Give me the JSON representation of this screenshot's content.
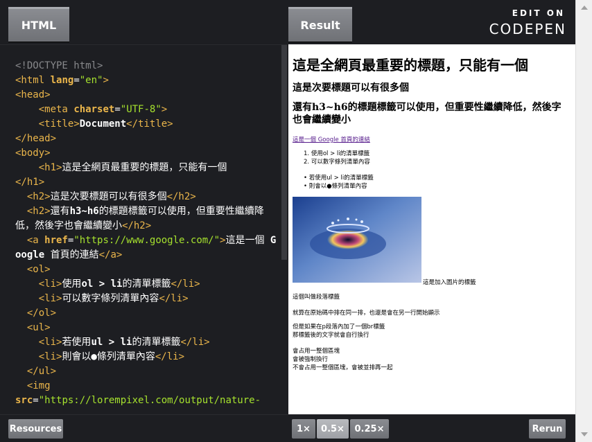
{
  "tabs": {
    "html": "HTML",
    "result": "Result"
  },
  "codepen": {
    "edit_on": "EDIT ON",
    "word": "CODEPEN"
  },
  "code_lines": [
    "<!DOCTYPE html>",
    "<html lang=\"en\">",
    "<head>",
    "<meta charset=\"UTF-8\">",
    "<title>Document</title>",
    "</head>",
    "<body>",
    "<h1>這是全網頁最重要的標題，只能有一個</h1>",
    "<h2>這是次要標題可以有很多個</h2>",
    "<h2>還有h3~h6的標題標籤可以使用，但重要性繼續降低，然後字也會繼續變小</h2>",
    "<a href=\"https://www.google.com/\">這是一個 Google 首頁的連結</a>",
    "<ol>",
    "<li>使用ol > li的清單標籤</li>",
    "<li>可以數字條列清單內容</li>",
    "</ol>",
    "<ul>",
    "<li>若使用ul > li的清單標籤</li>",
    "<li>則會以●條列清單內容</li>",
    "</ul>",
    "<img src=\"https://lorempixel.com/output/nature-"
  ],
  "code": {
    "doctype": "<!DOCTYPE html>",
    "html_open": "<html",
    "lang_attr": "lang",
    "lang_eq": "=",
    "lang_val": "\"en\"",
    "gt": ">",
    "head_open": "<head>",
    "meta_open": "<meta",
    "charset_attr": "charset",
    "charset_val": "\"UTF-8\"",
    "title_open": "<title>",
    "title_text": "Document",
    "title_close": "</title>",
    "head_close": "</head>",
    "body_open": "<body>",
    "h1_open": "<h1>",
    "h1_text": "這是全網頁最重要的標題，只能有一個",
    "h1_close": "</h1>",
    "h2_open": "<h2>",
    "h2a_text": "這是次要標題可以有很多個",
    "h2_close": "</h2>",
    "h2b_pre": "還有",
    "h2b_bold": "h3~h6",
    "h2b_post": "的標題標籤可以使用，但重要性繼續降低，然後字也會繼續變小",
    "a_open": "<a",
    "href_attr": "href",
    "href_val": "\"https://www.google.com/\"",
    "a_pre": "這是一個 ",
    "a_bold": "Google",
    "a_post": " 首頁的連結",
    "a_close": "</a>",
    "ol_open": "<ol>",
    "li_open": "<li>",
    "li1_pre": "使用",
    "li1_bold": "ol > li",
    "li1_post": "的清單標籤",
    "li_close": "</li>",
    "li2_text": "可以數字條列清單內容",
    "ol_close": "</ol>",
    "ul_open": "<ul>",
    "li3_pre": "若使用",
    "li3_bold": "ul > li",
    "li3_post": "的清單標籤",
    "li4_text": "則會以●條列清單內容",
    "ul_close": "</ul>",
    "img_open": "<img",
    "src_attr": "src",
    "src_val": "\"https://lorempixel.com/output/nature-"
  },
  "result": {
    "h1": "這是全網頁最重要的標題，只能有一個",
    "h2a": "這是次要標題可以有很多個",
    "h2b": "還有h3~h6的標題標籤可以使用，但重要性繼續降低，然後字也會繼續變小",
    "link": "這是一個 Google 首頁的連結",
    "ol": [
      "使用ol > li的清單標籤",
      "可以數字條列清單內容"
    ],
    "ul": [
      "若使用ul > li的清單標籤",
      "則會以●條列清單內容"
    ],
    "img_caption": "這是加入圖片的標籤",
    "p1": "這個叫做段落標籤",
    "p2": "就算在原始碼中排在同一排，也還是會在另一行開始顯示",
    "p3a": "但是如果在p段落內加了一個br標籤",
    "p3b": "那標籤後的文字就會自行換行",
    "p4a": "會占用一整個區塊",
    "p4b": "會被強制換行",
    "p4c": "不會占用一整個區塊，會被並排再一起"
  },
  "bottom": {
    "resources": "Resources",
    "zoom_1x": "1×",
    "zoom_05x": "0.5×",
    "zoom_025x": "0.25×",
    "zoom_selected": "0.5×",
    "rerun": "Rerun"
  },
  "colors": {
    "editor_bg": "#1d1e22",
    "tag": "#ebb64b",
    "string": "#a6e22e",
    "comment_gray": "#88898c",
    "link_visited": "#551a8b"
  }
}
